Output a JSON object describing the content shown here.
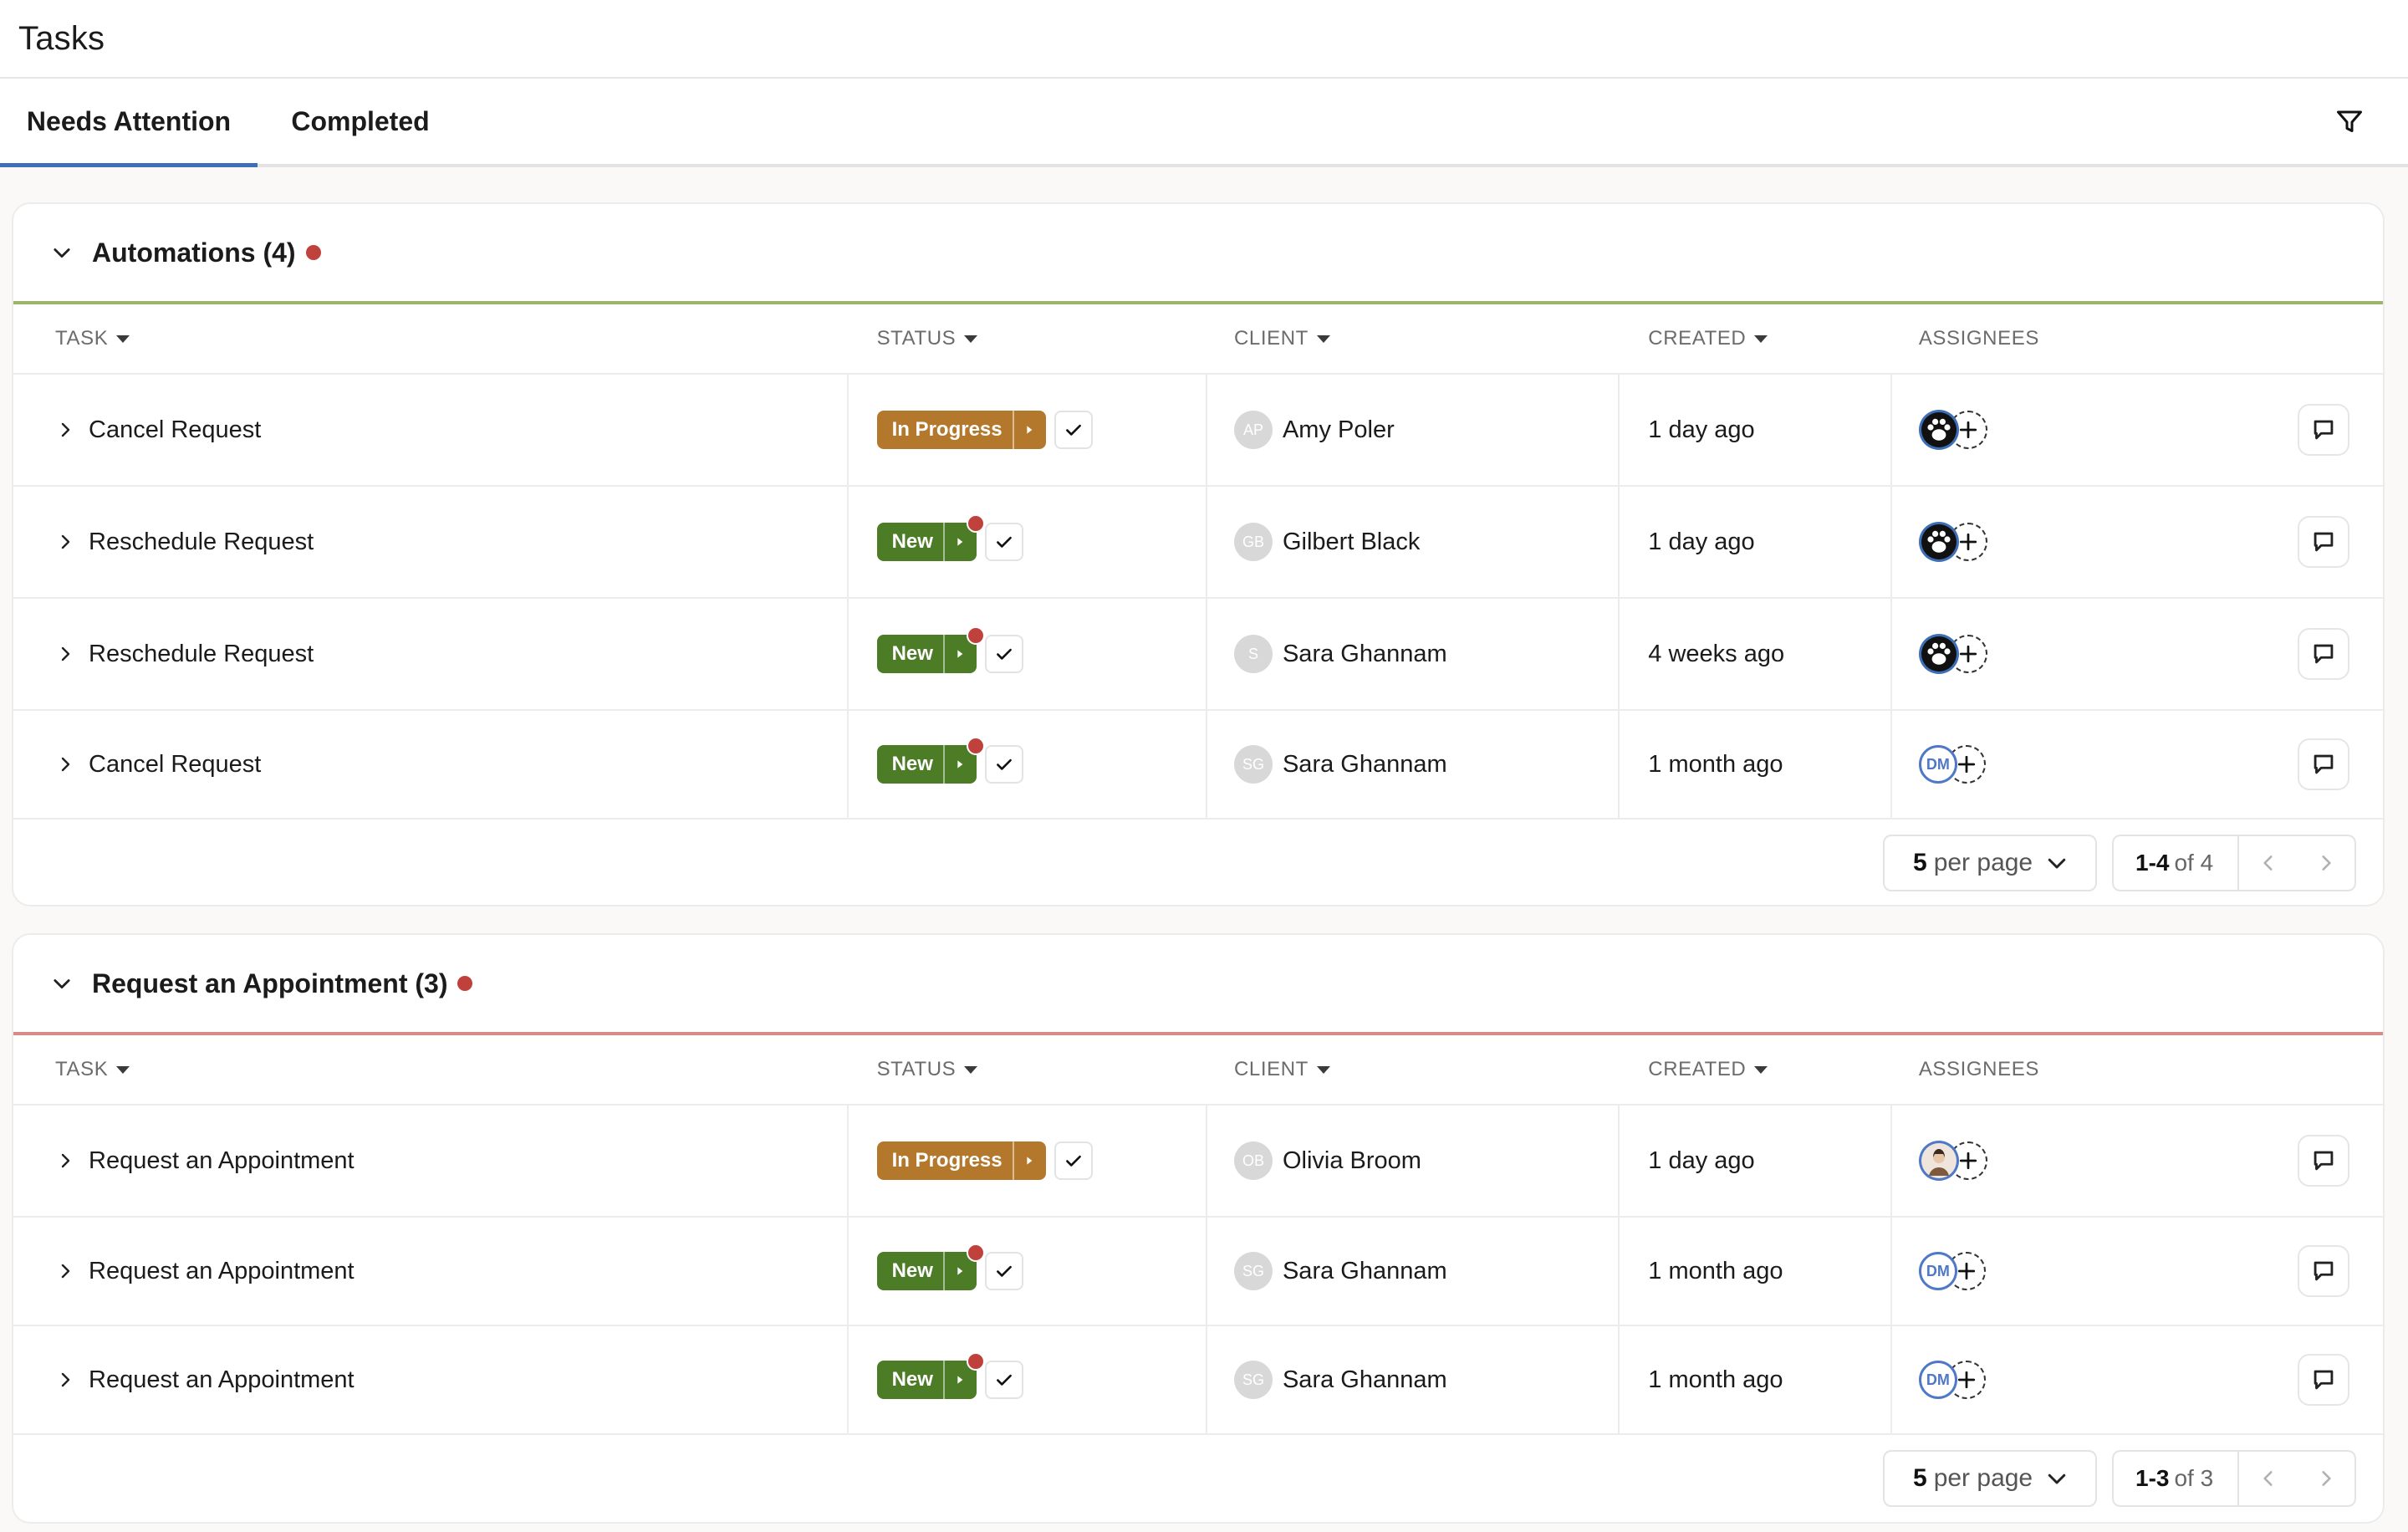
{
  "page": {
    "title": "Tasks"
  },
  "tabs": [
    {
      "label": "Needs Attention",
      "active": true
    },
    {
      "label": "Completed",
      "active": false
    }
  ],
  "colors": {
    "tab_active": "#3d6fb6",
    "in_progress": "#b4782c",
    "new": "#4d7c26",
    "alert_dot": "#c0413b",
    "automations_rule": "#9bb56a",
    "appointment_rule": "#d98a84"
  },
  "columns": {
    "task": "TASK",
    "status": "STATUS",
    "client": "CLIENT",
    "created": "CREATED",
    "assignees": "ASSIGNEES"
  },
  "sections": [
    {
      "title": "Automations (4)",
      "rows": [
        {
          "task": "Cancel Request",
          "status": "In Progress",
          "client_initials": "AP",
          "client": "Amy Poler",
          "created": "1 day ago",
          "assignee": "paw-icon"
        },
        {
          "task": "Reschedule Request",
          "status": "New",
          "client_initials": "GB",
          "client": "Gilbert Black",
          "created": "1 day ago",
          "assignee": "paw-icon"
        },
        {
          "task": "Reschedule Request",
          "status": "New",
          "client_initials": "S",
          "client": "Sara Ghannam",
          "created": "4 weeks ago",
          "assignee": "paw-icon"
        },
        {
          "task": "Cancel Request",
          "status": "New",
          "client_initials": "SG",
          "client": "Sara Ghannam",
          "created": "1 month ago",
          "assignee": "DM"
        }
      ],
      "pagination": {
        "per_page_value": "5",
        "per_page_label": "per page",
        "range": "1-4",
        "of": "of 4"
      }
    },
    {
      "title": "Request an Appointment (3)",
      "rows": [
        {
          "task": "Request an Appointment",
          "status": "In Progress",
          "client_initials": "OB",
          "client": "Olivia Broom",
          "created": "1 day ago",
          "assignee": "person-photo-icon"
        },
        {
          "task": "Request an Appointment",
          "status": "New",
          "client_initials": "SG",
          "client": "Sara Ghannam",
          "created": "1 month ago",
          "assignee": "DM"
        },
        {
          "task": "Request an Appointment",
          "status": "New",
          "client_initials": "SG",
          "client": "Sara Ghannam",
          "created": "1 month ago",
          "assignee": "DM"
        }
      ],
      "pagination": {
        "per_page_value": "5",
        "per_page_label": "per page",
        "range": "1-3",
        "of": "of 3"
      }
    }
  ]
}
